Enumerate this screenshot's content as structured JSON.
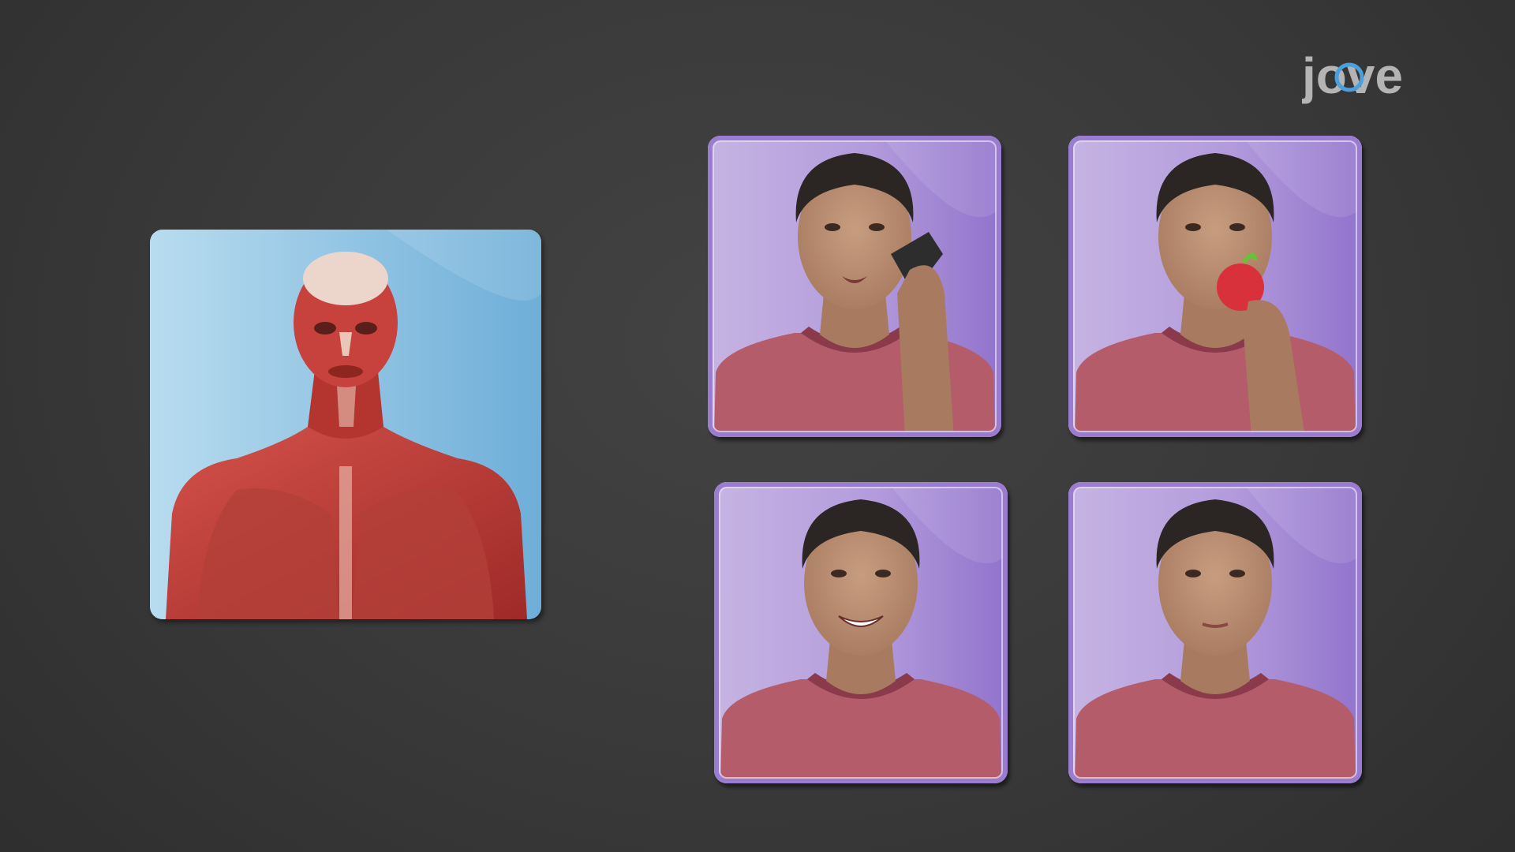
{
  "logo": {
    "text": "jove"
  },
  "colors": {
    "background": "#3c3c3c",
    "anatomy_card": "#8ec3e2",
    "face_card": "#a98ad6",
    "logo": "#b4b4b4",
    "logo_accent": "#4aa0dc"
  },
  "anatomy_card": {
    "image": "anatomy-muscle-illustration"
  },
  "face_cards": [
    {
      "image": "man-talking-on-phone"
    },
    {
      "image": "man-eating-apple"
    },
    {
      "image": "man-smiling"
    },
    {
      "image": "man-neutral-expression"
    }
  ]
}
